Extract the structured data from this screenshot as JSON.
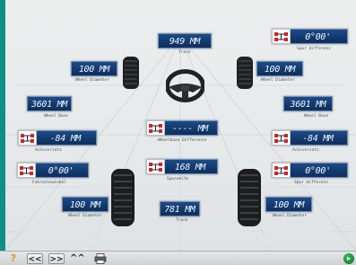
{
  "measurements": {
    "front_track": {
      "value": "949 MM",
      "label": "Track"
    },
    "front_right_toe": {
      "value": "0°00'",
      "label": "Spur differenz"
    },
    "front_left_wheel": {
      "value": "100 MM",
      "label": "Wheel Diameter"
    },
    "front_right_wheel": {
      "value": "100 MM",
      "label": "Wheel Diameter"
    },
    "left_wheelbase": {
      "value": "3601 MM",
      "label": "Wheel Base"
    },
    "right_wheelbase": {
      "value": "3601 MM",
      "label": "Wheel Base"
    },
    "axle_offset": {
      "value": "---- MM",
      "label": "Wheelbase Difference"
    },
    "left_offset": {
      "value": "-84 MM",
      "label": "Achsversatz"
    },
    "right_offset": {
      "value": "-84 MM",
      "label": "Achsversatz"
    },
    "left_thrust": {
      "value": "0°00'",
      "label": "Fahrachswinkel"
    },
    "center_lateral": {
      "value": "168 MM",
      "label": "Spurweite"
    },
    "right_toe": {
      "value": "0°00'",
      "label": "Spur differenz"
    },
    "rear_left_wheel": {
      "value": "100 MM",
      "label": "Wheel Diameter"
    },
    "rear_track": {
      "value": "781 MM",
      "label": "Track"
    },
    "rear_right_wheel": {
      "value": "100 MM",
      "label": "Wheel Diameter"
    }
  },
  "icons": {
    "car": "car-axle-icon",
    "steering": "steering-wheel-icon",
    "tire": "tire-icon"
  },
  "toolbar": {
    "help": "?",
    "back": "<<",
    "forward": ">>",
    "up": "^^",
    "print": "printer-icon",
    "ok": "OK"
  },
  "colors": {
    "value_box": "#123a6e",
    "background": "#e6e9ea",
    "frame": "#0f8f86",
    "accent_red": "#c9262b"
  }
}
